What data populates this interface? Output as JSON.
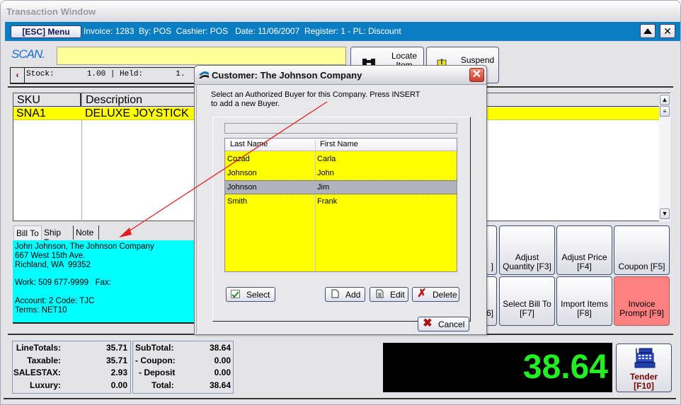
{
  "window": {
    "title": "Transaction Window"
  },
  "infobar": {
    "menu_label": "[ESC] Menu",
    "info_text": "Invoice: 1283  By: POS  Cashier: POS   Date: 11/06/2007  Register: 1 - PL: Discount",
    "up_icon": "triangle-up-icon",
    "close_label": "✕"
  },
  "scan": {
    "label": "SCAN.",
    "value": ""
  },
  "stock_bar": {
    "arrow": "‹",
    "text": "Stock:       1.00 | Held:       1."
  },
  "toolbar": {
    "locate_label": "Locate Item",
    "suspend_label": "Suspend"
  },
  "grid": {
    "columns": [
      "SKU",
      "Description"
    ],
    "rows": [
      {
        "sku": "SNA1",
        "description": "DELUXE JOYSTICK"
      }
    ]
  },
  "bill_tabs": [
    {
      "label": "Bill To",
      "active": true
    },
    {
      "label": "Ship To",
      "active": false
    },
    {
      "label": "Note",
      "active": false
    }
  ],
  "bill_to": {
    "lines": [
      "John Johnson, The Johnson Company",
      "667 West 15th Ave.",
      "Richland, WA  99352",
      "",
      "Work: 509 677-9999   Fax:",
      "",
      "Account: 2 Code: TJC",
      "Terms: NET10"
    ]
  },
  "function_buttons": {
    "row1": [
      {
        "label": "]",
        "partial": true
      },
      {
        "label": "Adjust Quantity [F3]"
      },
      {
        "label": "Adjust Price [F4]"
      },
      {
        "label": "Coupon [F5]"
      }
    ],
    "row2": [
      {
        "label": "6]",
        "partial": true
      },
      {
        "label": "Select Bill To [F7]"
      },
      {
        "label": "Import Items [F8]"
      },
      {
        "label": "Invoice Prompt [F9]",
        "color": "#ff8080"
      }
    ]
  },
  "totals_left": [
    {
      "label": "LineTotals:",
      "value": "35.71"
    },
    {
      "label": "Taxable:",
      "value": "35.71"
    },
    {
      "label": "SALESTAX:",
      "value": "2.93"
    },
    {
      "label": "Luxury:",
      "value": "0.00"
    }
  ],
  "totals_right": [
    {
      "label": "SubTotal:",
      "value": "38.64"
    },
    {
      "label": "- Coupon:",
      "value": "0.00"
    },
    {
      "label": " - Deposit",
      "value": "0.00"
    },
    {
      "label": "Total:",
      "value": "38.64"
    }
  ],
  "total_display": {
    "value": "38.64",
    "color": "#22ee22"
  },
  "tender": {
    "label_line1": "Tender",
    "label_line2": "[F10]"
  },
  "dialog": {
    "title": "Customer: The Johnson Company",
    "message": "Select an Authorized Buyer for this Company.  Press INSERT to add a new Buyer.",
    "search_value": "",
    "columns": [
      "Last Name",
      "First Name"
    ],
    "rows": [
      {
        "last": "Cozad",
        "first": "Carla",
        "selected": false
      },
      {
        "last": "Johnson",
        "first": "John",
        "selected": false
      },
      {
        "last": "Johnson",
        "first": "Jim",
        "selected": true
      },
      {
        "last": "Smith",
        "first": "Frank",
        "selected": false
      }
    ],
    "buttons": {
      "select": "Select",
      "add": "Add",
      "edit": "Edit",
      "delete": "Delete",
      "cancel": "Cancel"
    }
  },
  "annotation": {
    "arrow_color": "#e02020"
  }
}
